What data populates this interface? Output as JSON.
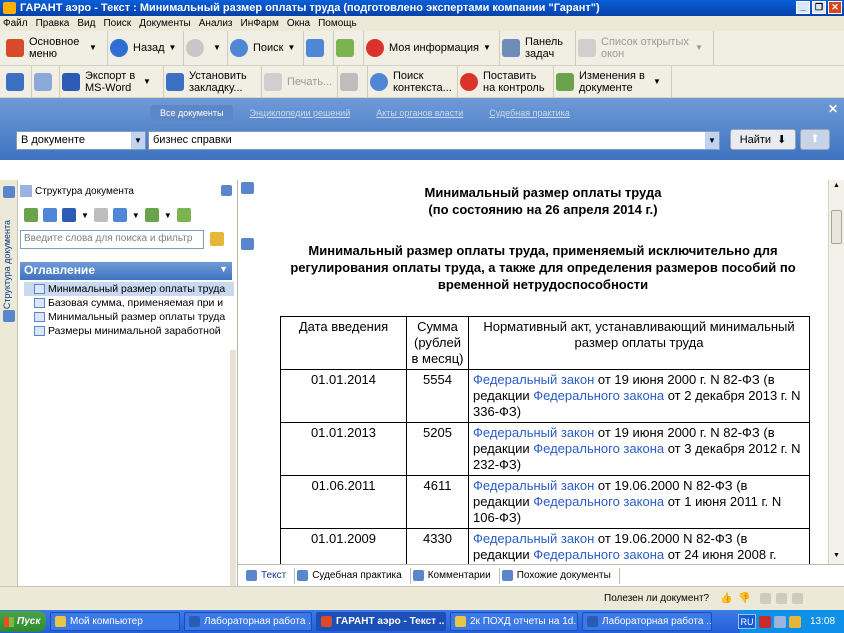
{
  "window": {
    "title": "ГАРАНТ аэро - Текст : Минимальный размер оплаты труда (подготовлено экспертами компании \"Гарант\")"
  },
  "menu": [
    "Файл",
    "Правка",
    "Вид",
    "Поиск",
    "Документы",
    "Анализ",
    "ИнФарм",
    "Окна",
    "Помощь"
  ],
  "toolbar1": {
    "main_menu": "Основное меню",
    "back": "Назад",
    "search": "Поиск",
    "my_info": "Моя информация",
    "task_panel": "Панель задач",
    "open_windows": "Список открытых окон"
  },
  "toolbar2": {
    "export_word": "Экспорт в MS-Word",
    "set_bookmark": "Установить закладку...",
    "print": "Печать...",
    "context_search": "Поиск контекста...",
    "put_on_control": "Поставить на контроль",
    "doc_changes": "Изменения в документе"
  },
  "search_panel": {
    "tabs": [
      "Все документы",
      "Энциклопедии решений",
      "Акты органов власти",
      "Судебная практика"
    ],
    "scope": "В документе",
    "query": "бизнес справки",
    "find_button": "Найти"
  },
  "left_panel": {
    "vertical_tab": "Структура документа",
    "header": "Структура документа",
    "search_placeholder": "Введите слова для поиска и фильтр",
    "toc_title": "Оглавление",
    "toc_items": [
      "Минимальный размер оплаты труда",
      "Базовая сумма, применяемая при и",
      "Минимальный размер оплаты труда",
      "Размеры минимальной заработной"
    ]
  },
  "document": {
    "title_line1": "Минимальный размер оплаты труда",
    "title_line2": "(по состоянию на 26 апреля 2014 г.)",
    "subtitle": "Минимальный размер оплаты труда, применяемый исключительно для регулирования оплаты труда, а также для определения размеров пособий по временной нетрудоспособности",
    "table": {
      "headers": [
        "Дата введения",
        "Сумма (рублей в месяц)",
        "Нормативный акт, устанавливающий минимальный размер оплаты труда"
      ],
      "rows": [
        {
          "date": "01.01.2014",
          "amount": "5554",
          "link1": "Федеральный закон",
          "text1": " от 19 июня 2000 г. N 82-ФЗ (в редакции ",
          "link2": "Федерального закона",
          "text2": " от 2 декабря 2013 г. N 336-ФЗ)"
        },
        {
          "date": "01.01.2013",
          "amount": "5205",
          "link1": "Федеральный закон",
          "text1": " от 19 июня 2000 г. N 82-ФЗ (в редакции ",
          "link2": "Федерального закона",
          "text2": " от 3 декабря 2012 г. N 232-ФЗ)"
        },
        {
          "date": "01.06.2011",
          "amount": "4611",
          "link1": "Федеральный закон",
          "text1": " от 19.06.2000 N 82-ФЗ (в редакции ",
          "link2": "Федерального закона",
          "text2": " от 1 июня 2011 г. N 106-ФЗ)"
        },
        {
          "date": "01.01.2009",
          "amount": "4330",
          "link1": "Федеральный закон",
          "text1": " от 19.06.2000 N 82-ФЗ (в редакции ",
          "link2": "Федерального закона",
          "text2": " от 24 июня 2008 г."
        }
      ]
    }
  },
  "bottom_tabs": [
    "Текст",
    "Судебная практика",
    "Комментарии",
    "Похожие документы"
  ],
  "status": {
    "useful_question": "Полезен ли документ?"
  },
  "taskbar": {
    "start": "Пуск",
    "tasks": [
      "Мой компьютер",
      "Лабораторная работа ...",
      "ГАРАНТ аэро - Текст ...",
      "2к ПОХД отчеты на 1d...",
      "Лабораторная работа ..."
    ],
    "lang": "RU",
    "clock": "13:08"
  },
  "colors": {
    "title_bar": "#0a5fd8",
    "search_panel": "#3e73c0",
    "link": "#2a5dc6",
    "toc_header": "#3e73c0"
  }
}
